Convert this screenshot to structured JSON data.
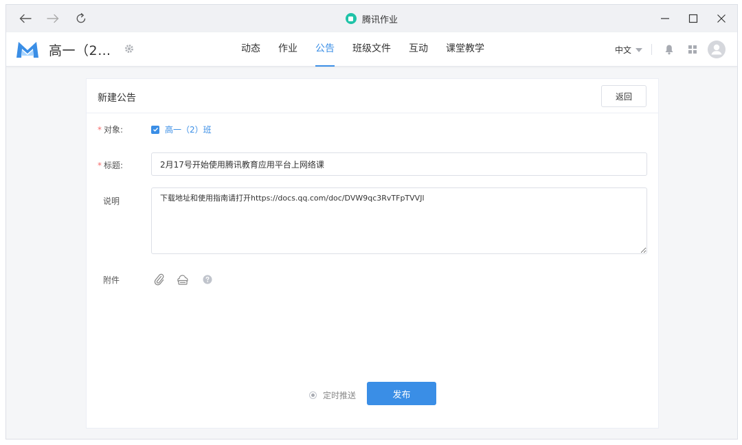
{
  "window": {
    "title": "腾讯作业",
    "controls": [
      "minimize-icon",
      "maximize-icon",
      "close-icon"
    ],
    "nav": [
      "back-arrow-icon",
      "forward-arrow-icon",
      "refresh-icon"
    ]
  },
  "header": {
    "class_name": "高一（2…",
    "tabs": [
      {
        "label": "动态",
        "active": false
      },
      {
        "label": "作业",
        "active": false
      },
      {
        "label": "公告",
        "active": true
      },
      {
        "label": "班级文件",
        "active": false
      },
      {
        "label": "互动",
        "active": false
      },
      {
        "label": "课堂教学",
        "active": false
      }
    ],
    "language": "中文",
    "icons": [
      "bell-icon",
      "apps-grid-icon",
      "avatar"
    ]
  },
  "form": {
    "card_title": "新建公告",
    "back_label": "返回",
    "target_label": "对象:",
    "target_value": "高一（2）班",
    "target_checked": true,
    "title_label": "标题:",
    "title_value": "2月17号开始使用腾讯教育应用平台上网络课",
    "desc_label": "说明",
    "desc_value": "下载地址和使用指南请打开https://docs.qq.com/doc/DVW9qc3RvTFpTVVJl",
    "attach_label": "附件",
    "attach_icons": [
      "paperclip-icon",
      "cloud-drive-icon",
      "help-icon"
    ],
    "required_mark": "*",
    "schedule_label": "定时推送",
    "publish_label": "发布"
  },
  "colors": {
    "accent": "#3a8ee6",
    "required": "#f56c6c",
    "app_logo": "#20c3a8"
  }
}
